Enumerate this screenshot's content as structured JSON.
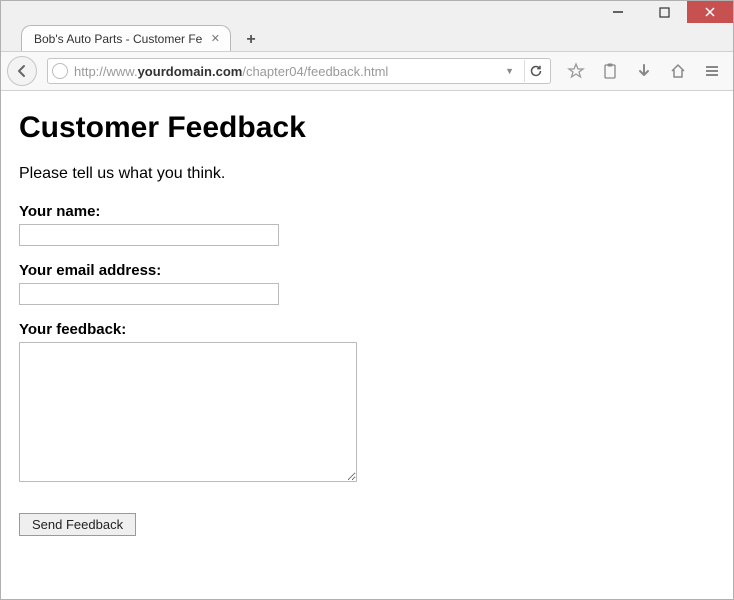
{
  "window": {
    "tab_title": "Bob's Auto Parts - Customer Fe...",
    "url_prefix": "http://www.",
    "url_bold": "yourdomain.com",
    "url_suffix": "/chapter04/feedback.html"
  },
  "page": {
    "heading": "Customer Feedback",
    "intro": "Please tell us what you think.",
    "labels": {
      "name": "Your name:",
      "email": "Your email address:",
      "feedback": "Your feedback:"
    },
    "values": {
      "name": "",
      "email": "",
      "feedback": ""
    },
    "submit_label": "Send Feedback"
  }
}
